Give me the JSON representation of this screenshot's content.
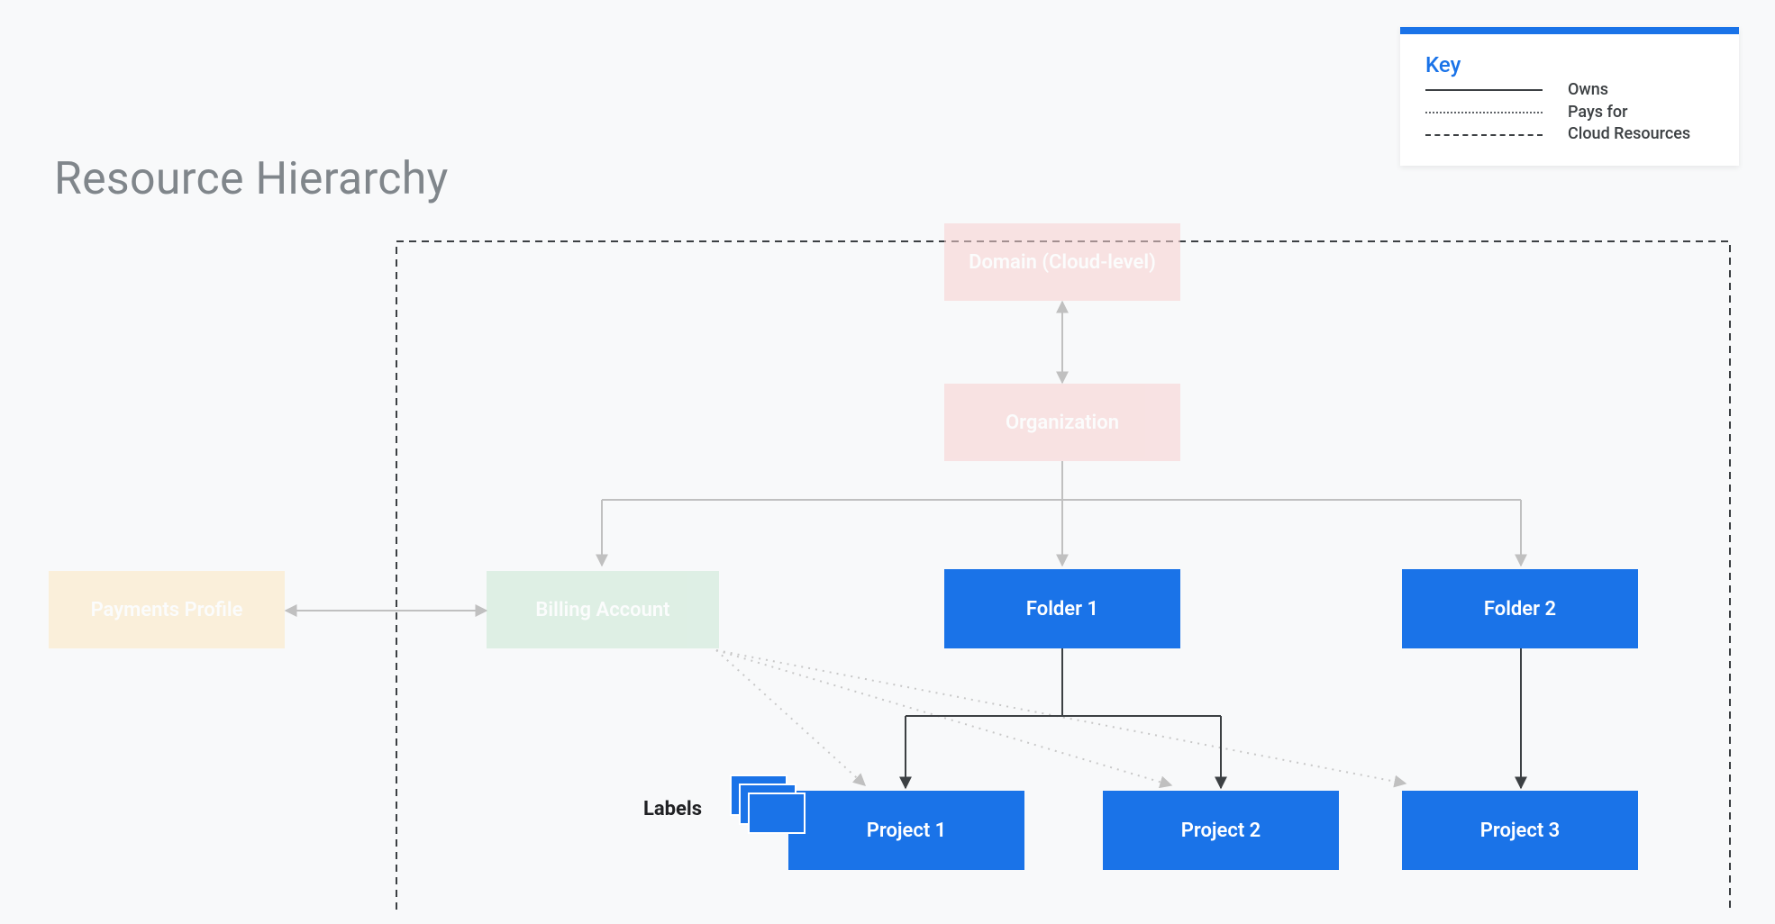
{
  "title": "Resource Hierarchy",
  "legend": {
    "key_label": "Key",
    "items": [
      {
        "sample": "solid",
        "text": "Owns"
      },
      {
        "sample": "dotted",
        "text": "Pays for"
      },
      {
        "sample": "dashed",
        "text": "Cloud Resources"
      }
    ]
  },
  "nodes": {
    "domain": "Domain (Cloud-level)",
    "organization": "Organization",
    "payments_profile": "Payments Profile",
    "billing_account": "Billing Account",
    "folder1": "Folder 1",
    "folder2": "Folder 2",
    "project1": "Project 1",
    "project2": "Project 2",
    "project3": "Project 3"
  },
  "labels_caption": "Labels",
  "colors": {
    "accent": "#1A73E8",
    "faded_pink": "#f8d0d0",
    "faded_green": "#c9e7d3",
    "faded_yellow": "#fde7c0",
    "text_gray": "#80868b",
    "line_dark": "#3c4043",
    "line_light": "#b0b0b0"
  }
}
